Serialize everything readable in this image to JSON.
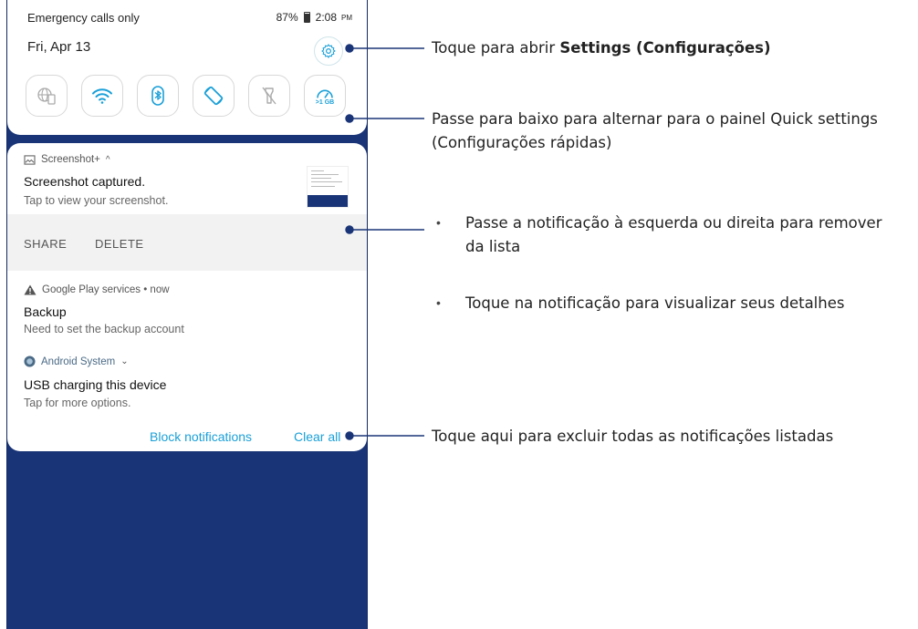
{
  "status_bar": {
    "left_text": "Emergency calls only",
    "battery": "87%",
    "time": "2:08",
    "ampm": "PM"
  },
  "header": {
    "date": "Fri, Apr 13",
    "settings_icon": "gear-icon"
  },
  "quick_tiles": [
    {
      "icon": "globe-phone-icon",
      "label": ""
    },
    {
      "icon": "wifi-icon",
      "label": ""
    },
    {
      "icon": "bluetooth-icon",
      "label": ""
    },
    {
      "icon": "auto-rotate-icon",
      "label": ""
    },
    {
      "icon": "flashlight-off-icon",
      "label": ""
    },
    {
      "icon": "data-usage-icon",
      "label": ">1 GB"
    }
  ],
  "notifications": [
    {
      "app": "Screenshot+",
      "title": "Screenshot captured.",
      "text": "Tap to view your screenshot.",
      "actions": [
        "SHARE",
        "DELETE"
      ]
    },
    {
      "app": "Google Play services • now",
      "title": "Backup",
      "text": "Need to set the backup account"
    },
    {
      "app": "Android System",
      "title": "USB charging this device",
      "text": "Tap for more options."
    }
  ],
  "footer": {
    "block_label": "Block notifications",
    "clear_label": "Clear all"
  },
  "callouts": {
    "settings_prefix": "Toque para abrir ",
    "settings_bold": "Settings (Configurações)",
    "swipe_down": "Passe para baixo para alternar para o painel Quick settings (Configurações rápidas)",
    "swipe_side": "Passe a notificação à esquerda ou direita para remover da lista",
    "tap_notif": "Toque na notificação para visualizar seus detalhes",
    "clear_all": "Toque aqui para excluir todas as notificações listadas",
    "bullet": "•"
  },
  "colors": {
    "accent": "#1aa0d8",
    "wallpaper": "#1a3577",
    "callout_line": "#1a3577"
  }
}
